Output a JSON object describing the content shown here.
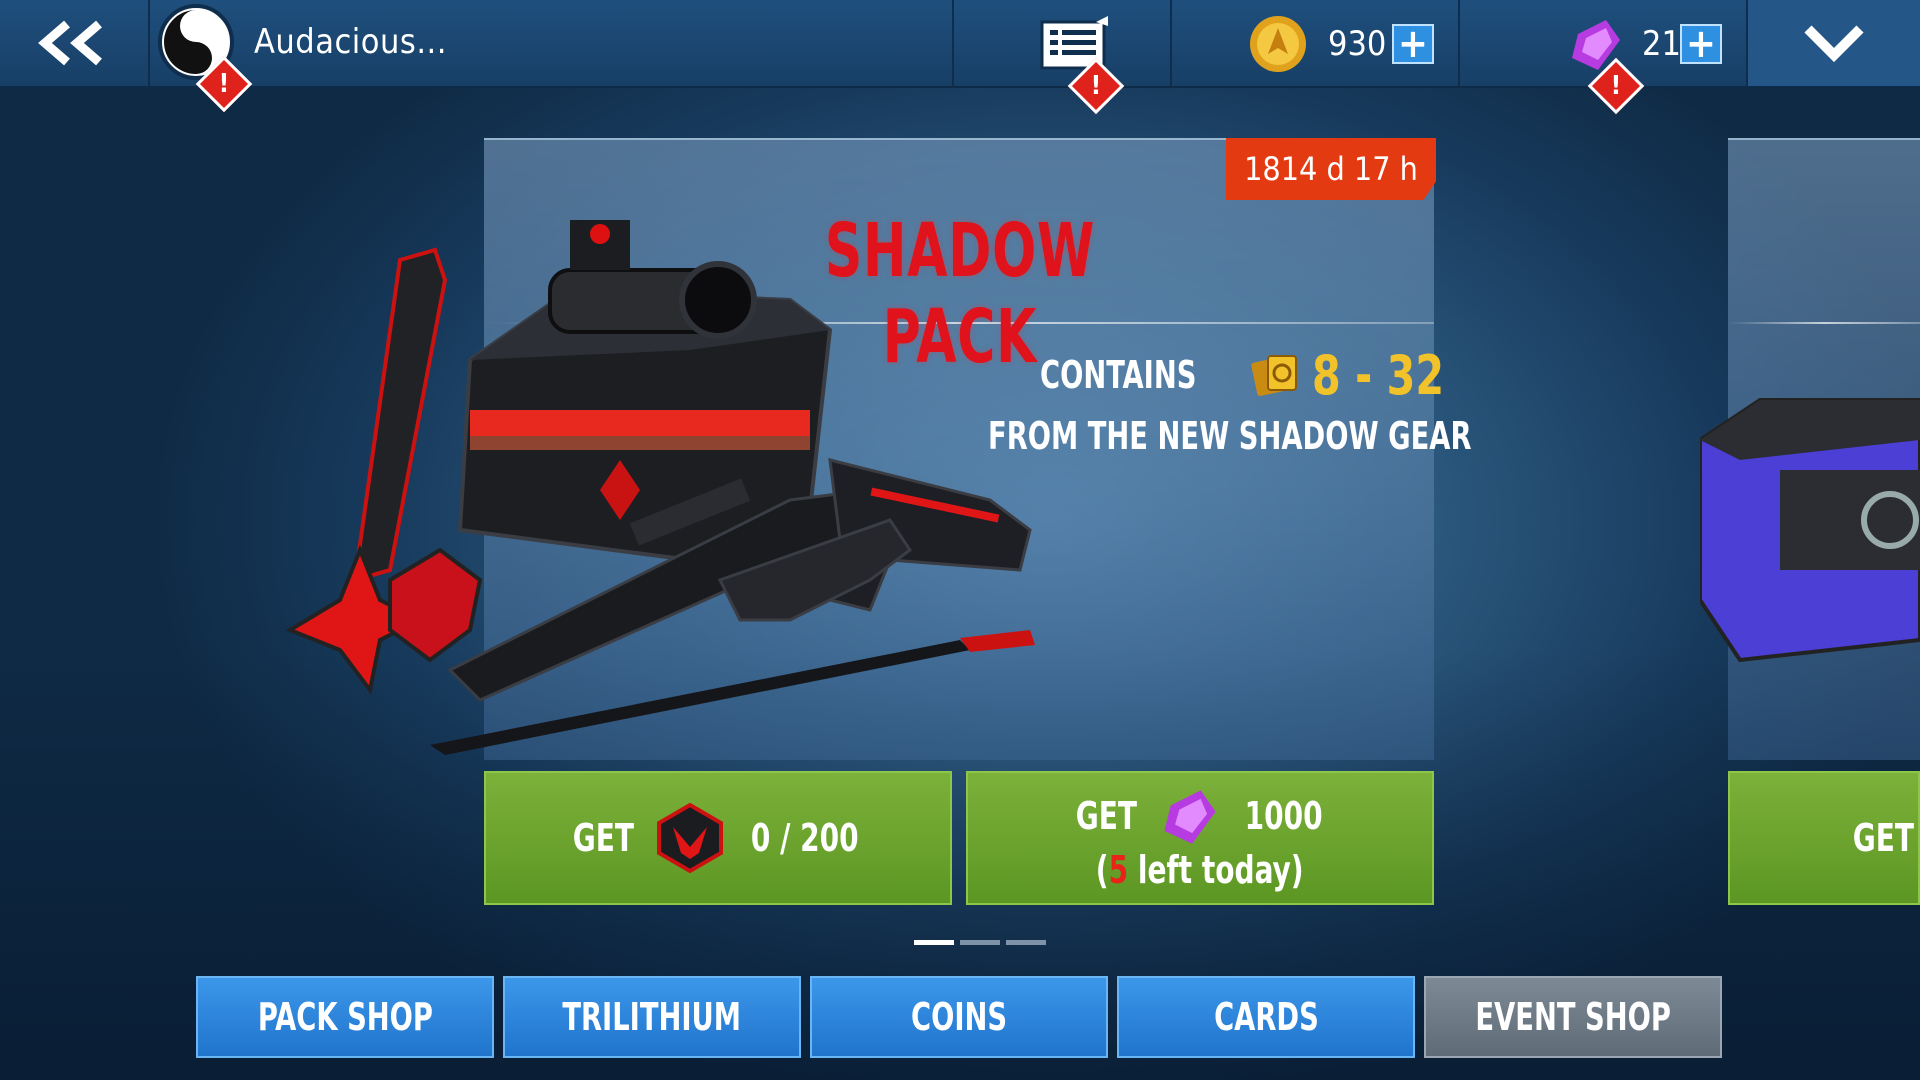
{
  "topbar": {
    "player_name": "Audacious...",
    "alert_symbol": "!",
    "coins": {
      "value": "930",
      "plus": "+"
    },
    "trilithium": {
      "value": "21",
      "plus": "+"
    }
  },
  "offer": {
    "timer": "1814 d 17 h",
    "title": "SHADOW PACK",
    "contains_label": "CONTAINS",
    "range": "8 - 32",
    "gear_text": "FROM THE NEW SHADOW GEAR",
    "buy_shadow": {
      "label": "GET",
      "progress": "0 / 200"
    },
    "buy_crystal": {
      "label": "GET",
      "price": "1000",
      "left_open": "(",
      "left_count": "5",
      "left_rest": " left today)"
    }
  },
  "next_offer": {
    "label": "GET"
  },
  "pager": {
    "pages": 3,
    "active": 0
  },
  "tabs": [
    {
      "label": "PACK SHOP"
    },
    {
      "label": "TRILITHIUM"
    },
    {
      "label": "COINS"
    },
    {
      "label": "CARDS"
    },
    {
      "label": "EVENT SHOP"
    }
  ],
  "colors": {
    "title_red": "#e0121b",
    "timer_orange": "#e43a12",
    "buy_green": "#6aa42e",
    "tab_blue": "#2d86de",
    "tab_grey": "#6f7b87",
    "range_gold": "#f2c22a"
  },
  "icons": {
    "back": "double-chevron-left-icon",
    "avatar": "yin-yang-icon",
    "inbox": "news-list-icon",
    "coin": "coin-icon",
    "crystal": "trilithium-crystal-icon",
    "menu": "chevron-down-icon",
    "cards": "cards-icon",
    "emblem": "shadow-emblem-icon"
  }
}
